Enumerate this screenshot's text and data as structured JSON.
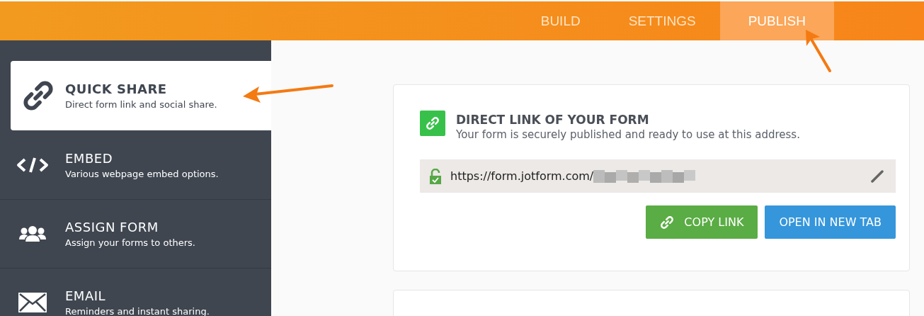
{
  "tabs": [
    {
      "label": "BUILD",
      "selected": false
    },
    {
      "label": "SETTINGS",
      "selected": false
    },
    {
      "label": "PUBLISH",
      "selected": true
    }
  ],
  "sidebar": {
    "items": [
      {
        "kind": "link",
        "title": "QUICK SHARE",
        "description": "Direct form link and social share.",
        "selected": true
      },
      {
        "kind": "code",
        "title": "EMBED",
        "description": "Various webpage embed options.",
        "selected": false
      },
      {
        "kind": "people",
        "title": "ASSIGN FORM",
        "description": "Assign your forms to others.",
        "selected": false
      },
      {
        "kind": "mail",
        "title": "EMAIL",
        "description": "Reminders and instant sharing.",
        "selected": false
      }
    ]
  },
  "card": {
    "title": "DIRECT LINK OF YOUR FORM",
    "subtitle": "Your form is securely published and ready to use at this address.",
    "url": "https://form.jotform.com/",
    "buttons": [
      {
        "kind": "copy",
        "label": "COPY LINK"
      },
      {
        "kind": "open",
        "label": "OPEN IN NEW TAB"
      }
    ]
  }
}
